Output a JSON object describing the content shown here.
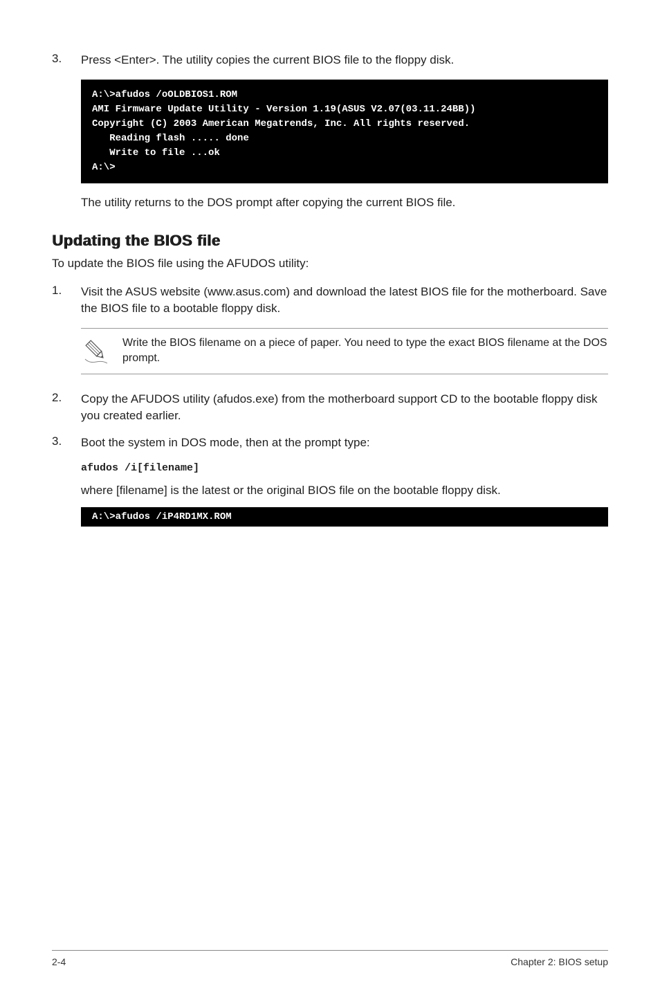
{
  "steps": {
    "step3a": {
      "num": "3.",
      "text": "Press <Enter>. The utility copies the current BIOS file to the floppy disk."
    },
    "code1": "A:\\>afudos /oOLDBIOS1.ROM\nAMI Firmware Update Utility - Version 1.19(ASUS V2.07(03.11.24BB))\nCopyright (C) 2003 American Megatrends, Inc. All rights reserved.\n   Reading flash ..... done\n   Write to file ...ok\nA:\\>",
    "return_text": "The utility returns to the DOS prompt after copying the current BIOS file."
  },
  "section": {
    "heading": "Updating the BIOS file",
    "intro": "To update the BIOS file using the AFUDOS utility:",
    "step1": {
      "num": "1.",
      "text": "Visit the ASUS website (www.asus.com) and download the latest BIOS file for the motherboard. Save the BIOS file to a bootable floppy disk."
    },
    "note": "Write the BIOS filename on a piece of paper. You need to type the exact BIOS filename at the DOS prompt.",
    "step2": {
      "num": "2.",
      "text": "Copy the AFUDOS utility (afudos.exe) from the motherboard support CD to the bootable floppy disk you created earlier."
    },
    "step3": {
      "num": "3.",
      "text": "Boot the system in DOS mode, then at the prompt type:"
    },
    "cmd": "afudos /i[filename]",
    "where": "where [filename] is the latest or the original BIOS file on the bootable floppy disk.",
    "code2": "A:\\>afudos /iP4RD1MX.ROM"
  },
  "footer": {
    "left": "2-4",
    "right": "Chapter 2: BIOS setup"
  }
}
